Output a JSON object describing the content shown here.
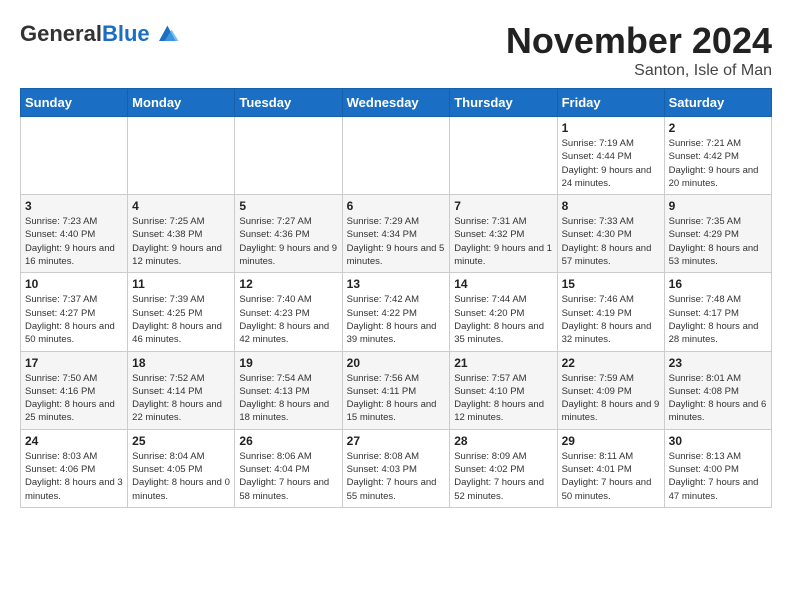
{
  "header": {
    "logo_general": "General",
    "logo_blue": "Blue",
    "month_title": "November 2024",
    "location": "Santon, Isle of Man"
  },
  "days_of_week": [
    "Sunday",
    "Monday",
    "Tuesday",
    "Wednesday",
    "Thursday",
    "Friday",
    "Saturday"
  ],
  "weeks": [
    [
      {
        "day": "",
        "info": ""
      },
      {
        "day": "",
        "info": ""
      },
      {
        "day": "",
        "info": ""
      },
      {
        "day": "",
        "info": ""
      },
      {
        "day": "",
        "info": ""
      },
      {
        "day": "1",
        "info": "Sunrise: 7:19 AM\nSunset: 4:44 PM\nDaylight: 9 hours and 24 minutes."
      },
      {
        "day": "2",
        "info": "Sunrise: 7:21 AM\nSunset: 4:42 PM\nDaylight: 9 hours and 20 minutes."
      }
    ],
    [
      {
        "day": "3",
        "info": "Sunrise: 7:23 AM\nSunset: 4:40 PM\nDaylight: 9 hours and 16 minutes."
      },
      {
        "day": "4",
        "info": "Sunrise: 7:25 AM\nSunset: 4:38 PM\nDaylight: 9 hours and 12 minutes."
      },
      {
        "day": "5",
        "info": "Sunrise: 7:27 AM\nSunset: 4:36 PM\nDaylight: 9 hours and 9 minutes."
      },
      {
        "day": "6",
        "info": "Sunrise: 7:29 AM\nSunset: 4:34 PM\nDaylight: 9 hours and 5 minutes."
      },
      {
        "day": "7",
        "info": "Sunrise: 7:31 AM\nSunset: 4:32 PM\nDaylight: 9 hours and 1 minute."
      },
      {
        "day": "8",
        "info": "Sunrise: 7:33 AM\nSunset: 4:30 PM\nDaylight: 8 hours and 57 minutes."
      },
      {
        "day": "9",
        "info": "Sunrise: 7:35 AM\nSunset: 4:29 PM\nDaylight: 8 hours and 53 minutes."
      }
    ],
    [
      {
        "day": "10",
        "info": "Sunrise: 7:37 AM\nSunset: 4:27 PM\nDaylight: 8 hours and 50 minutes."
      },
      {
        "day": "11",
        "info": "Sunrise: 7:39 AM\nSunset: 4:25 PM\nDaylight: 8 hours and 46 minutes."
      },
      {
        "day": "12",
        "info": "Sunrise: 7:40 AM\nSunset: 4:23 PM\nDaylight: 8 hours and 42 minutes."
      },
      {
        "day": "13",
        "info": "Sunrise: 7:42 AM\nSunset: 4:22 PM\nDaylight: 8 hours and 39 minutes."
      },
      {
        "day": "14",
        "info": "Sunrise: 7:44 AM\nSunset: 4:20 PM\nDaylight: 8 hours and 35 minutes."
      },
      {
        "day": "15",
        "info": "Sunrise: 7:46 AM\nSunset: 4:19 PM\nDaylight: 8 hours and 32 minutes."
      },
      {
        "day": "16",
        "info": "Sunrise: 7:48 AM\nSunset: 4:17 PM\nDaylight: 8 hours and 28 minutes."
      }
    ],
    [
      {
        "day": "17",
        "info": "Sunrise: 7:50 AM\nSunset: 4:16 PM\nDaylight: 8 hours and 25 minutes."
      },
      {
        "day": "18",
        "info": "Sunrise: 7:52 AM\nSunset: 4:14 PM\nDaylight: 8 hours and 22 minutes."
      },
      {
        "day": "19",
        "info": "Sunrise: 7:54 AM\nSunset: 4:13 PM\nDaylight: 8 hours and 18 minutes."
      },
      {
        "day": "20",
        "info": "Sunrise: 7:56 AM\nSunset: 4:11 PM\nDaylight: 8 hours and 15 minutes."
      },
      {
        "day": "21",
        "info": "Sunrise: 7:57 AM\nSunset: 4:10 PM\nDaylight: 8 hours and 12 minutes."
      },
      {
        "day": "22",
        "info": "Sunrise: 7:59 AM\nSunset: 4:09 PM\nDaylight: 8 hours and 9 minutes."
      },
      {
        "day": "23",
        "info": "Sunrise: 8:01 AM\nSunset: 4:08 PM\nDaylight: 8 hours and 6 minutes."
      }
    ],
    [
      {
        "day": "24",
        "info": "Sunrise: 8:03 AM\nSunset: 4:06 PM\nDaylight: 8 hours and 3 minutes."
      },
      {
        "day": "25",
        "info": "Sunrise: 8:04 AM\nSunset: 4:05 PM\nDaylight: 8 hours and 0 minutes."
      },
      {
        "day": "26",
        "info": "Sunrise: 8:06 AM\nSunset: 4:04 PM\nDaylight: 7 hours and 58 minutes."
      },
      {
        "day": "27",
        "info": "Sunrise: 8:08 AM\nSunset: 4:03 PM\nDaylight: 7 hours and 55 minutes."
      },
      {
        "day": "28",
        "info": "Sunrise: 8:09 AM\nSunset: 4:02 PM\nDaylight: 7 hours and 52 minutes."
      },
      {
        "day": "29",
        "info": "Sunrise: 8:11 AM\nSunset: 4:01 PM\nDaylight: 7 hours and 50 minutes."
      },
      {
        "day": "30",
        "info": "Sunrise: 8:13 AM\nSunset: 4:00 PM\nDaylight: 7 hours and 47 minutes."
      }
    ]
  ]
}
